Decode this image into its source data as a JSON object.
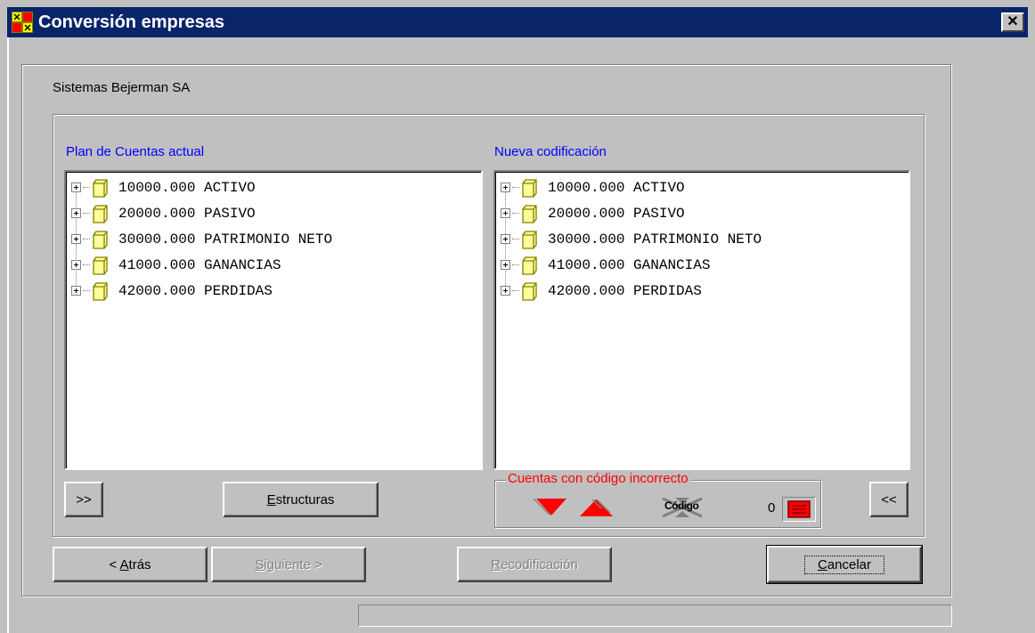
{
  "window": {
    "title": "Conversión empresas",
    "close_glyph": "✕"
  },
  "company": "Sistemas Bejerman SA",
  "left_panel": {
    "label": "Plan de Cuentas actual",
    "items": [
      {
        "code": "10000.000",
        "name": "ACTIVO"
      },
      {
        "code": "20000.000",
        "name": "PASIVO"
      },
      {
        "code": "30000.000",
        "name": "PATRIMONIO NETO"
      },
      {
        "code": "41000.000",
        "name": "GANANCIAS"
      },
      {
        "code": "42000.000",
        "name": "PERDIDAS"
      }
    ]
  },
  "right_panel": {
    "label": "Nueva codificación",
    "items": [
      {
        "code": "10000.000",
        "name": "ACTIVO"
      },
      {
        "code": "20000.000",
        "name": "PASIVO"
      },
      {
        "code": "30000.000",
        "name": "PATRIMONIO NETO"
      },
      {
        "code": "41000.000",
        "name": "GANANCIAS"
      },
      {
        "code": "42000.000",
        "name": "PERDIDAS"
      }
    ]
  },
  "buttons": {
    "move_right": ">>",
    "estructuras_mnemonic": "E",
    "estructuras_rest": "structuras",
    "move_left": "<<",
    "back_prefix": "< ",
    "back_mnemonic": "A",
    "back_rest": "trás",
    "next_mnemonic": "S",
    "next_rest": "iguiente >",
    "recode_mnemonic": "R",
    "recode_rest": "ecodificación",
    "cancel_mnemonic": "C",
    "cancel_rest": "ancelar"
  },
  "incorrect_accounts": {
    "label": "Cuentas con código incorrecto",
    "code_tool_label": "Código",
    "count": "0"
  },
  "colors": {
    "title_bg": "#0a246a",
    "panel_label": "#0000ff",
    "incorrect_label": "#ff0000",
    "arrow_red": "#ff0000"
  }
}
